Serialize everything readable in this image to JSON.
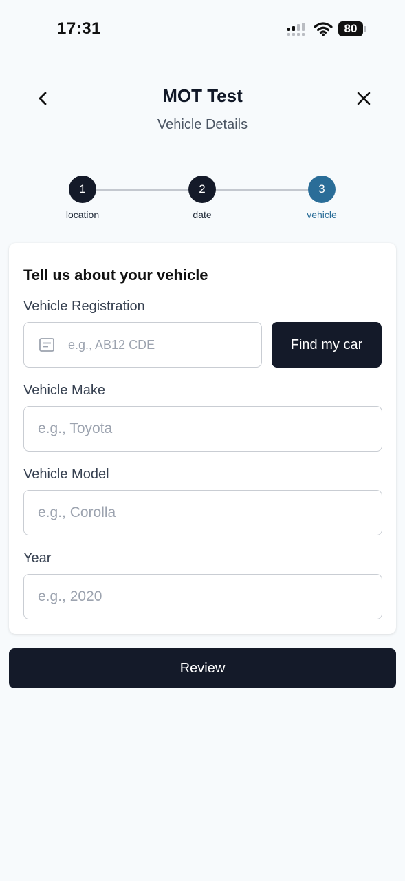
{
  "status_bar": {
    "time": "17:31",
    "battery": "80",
    "icons": [
      "cellular-signal-icon",
      "wifi-icon",
      "battery-icon"
    ]
  },
  "header": {
    "title": "MOT Test",
    "subtitle": "Vehicle Details",
    "back_icon": "chevron-left-icon",
    "close_icon": "close-icon"
  },
  "stepper": {
    "steps": [
      {
        "number": "1",
        "label": "location",
        "state": "complete"
      },
      {
        "number": "2",
        "label": "date",
        "state": "complete"
      },
      {
        "number": "3",
        "label": "vehicle",
        "state": "active"
      }
    ],
    "colors": {
      "complete": "#141a29",
      "active": "#2a6d98",
      "line": "#c4c8cf"
    }
  },
  "form": {
    "heading": "Tell us about your vehicle",
    "registration": {
      "label": "Vehicle Registration",
      "placeholder": "e.g., AB12 CDE",
      "value": "",
      "icon": "license-plate-icon",
      "find_button_label": "Find my car"
    },
    "make": {
      "label": "Vehicle Make",
      "placeholder": "e.g., Toyota",
      "value": ""
    },
    "model": {
      "label": "Vehicle Model",
      "placeholder": "e.g., Corolla",
      "value": ""
    },
    "year": {
      "label": "Year",
      "placeholder": "e.g., 2020",
      "value": ""
    }
  },
  "review_button_label": "Review",
  "colors": {
    "background": "#f7fafc",
    "primary": "#141a29",
    "accent": "#2a6d98"
  }
}
